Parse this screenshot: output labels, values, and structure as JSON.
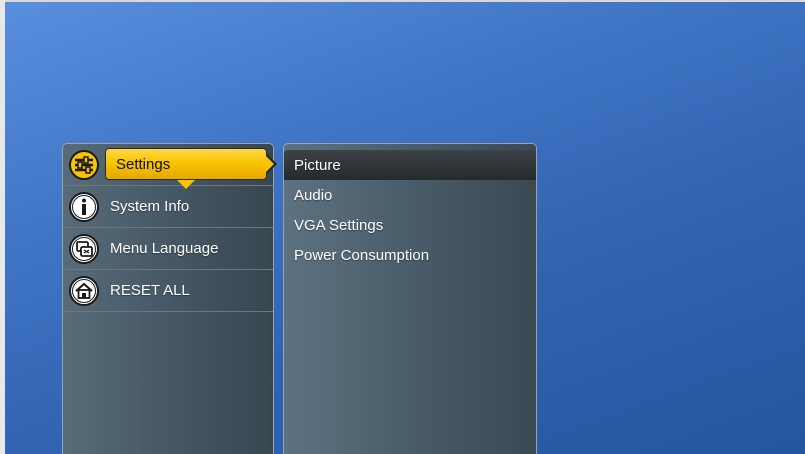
{
  "main_menu": {
    "items": [
      {
        "label": "Settings",
        "icon": "sliders-icon",
        "selected": true
      },
      {
        "label": "System Info",
        "icon": "info-icon",
        "selected": false
      },
      {
        "label": "Menu Language",
        "icon": "language-icon",
        "selected": false
      },
      {
        "label": "RESET ALL",
        "icon": "home-reset-icon",
        "selected": false
      }
    ]
  },
  "sub_menu": {
    "items": [
      {
        "label": "Picture",
        "selected": true
      },
      {
        "label": "Audio",
        "selected": false
      },
      {
        "label": "VGA Settings",
        "selected": false
      },
      {
        "label": "Power Consumption",
        "selected": false
      }
    ]
  },
  "colors": {
    "highlight": "#f7c500",
    "background": "#3f74c4"
  }
}
